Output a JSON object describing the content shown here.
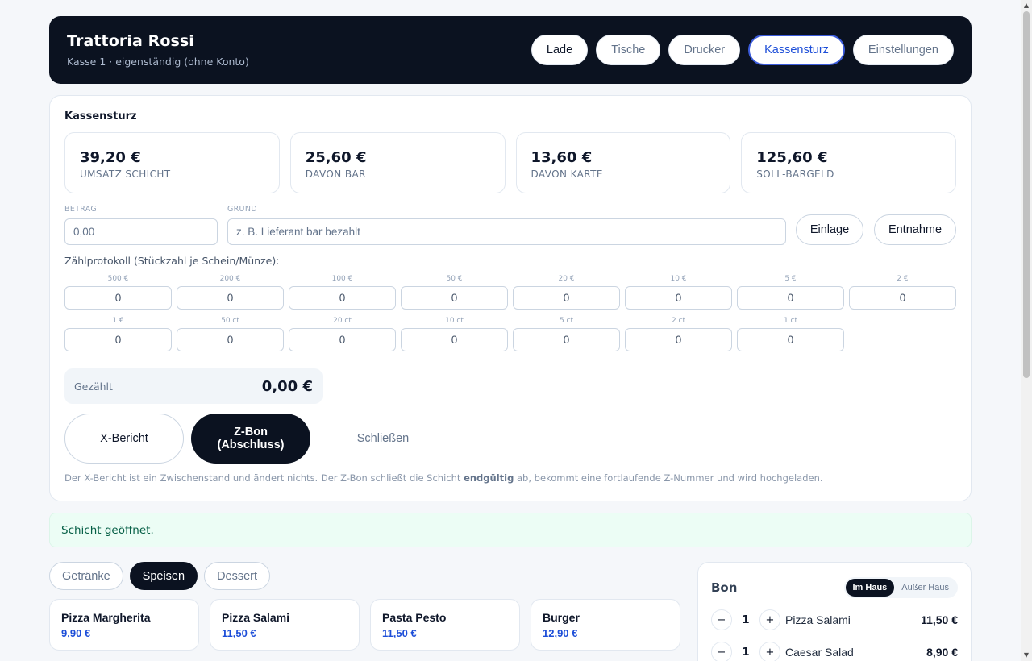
{
  "header": {
    "title": "Trattoria Rossi",
    "subtitle": "Kasse 1 · eigenständig (ohne Konto)",
    "nav": [
      {
        "label": "Lade"
      },
      {
        "label": "Tische"
      },
      {
        "label": "Drucker"
      },
      {
        "label": "Kassensturz",
        "active": true
      },
      {
        "label": "Einstellungen"
      }
    ]
  },
  "kassensturz": {
    "title": "Kassensturz",
    "stats": [
      {
        "value": "39,20 €",
        "label": "UMSATZ SCHICHT"
      },
      {
        "value": "25,60 €",
        "label": "DAVON BAR"
      },
      {
        "value": "13,60 €",
        "label": "DAVON KARTE"
      },
      {
        "value": "125,60 €",
        "label": "SOLL-BARGELD"
      }
    ],
    "amount_label": "BETRAG",
    "amount_placeholder": "0,00",
    "reason_label": "GRUND",
    "reason_placeholder": "z. B. Lieferant bar bezahlt",
    "deposit_label": "Einlage",
    "withdraw_label": "Entnahme",
    "count_title": "Zählprotokoll (Stückzahl je Schein/Münze):",
    "denominations": [
      {
        "label": "500 €",
        "value": "0"
      },
      {
        "label": "200 €",
        "value": "0"
      },
      {
        "label": "100 €",
        "value": "0"
      },
      {
        "label": "50 €",
        "value": "0"
      },
      {
        "label": "20 €",
        "value": "0"
      },
      {
        "label": "10 €",
        "value": "0"
      },
      {
        "label": "5 €",
        "value": "0"
      },
      {
        "label": "2 €",
        "value": "0"
      },
      {
        "label": "1 €",
        "value": "0"
      },
      {
        "label": "50 ct",
        "value": "0"
      },
      {
        "label": "20 ct",
        "value": "0"
      },
      {
        "label": "10 ct",
        "value": "0"
      },
      {
        "label": "5 ct",
        "value": "0"
      },
      {
        "label": "2 ct",
        "value": "0"
      },
      {
        "label": "1 ct",
        "value": "0"
      }
    ],
    "counted_label": "Gezählt",
    "counted_value": "0,00 €",
    "x_report_label": "X-Bericht",
    "z_bon_line1": "Z-Bon",
    "z_bon_line2": "(Abschluss)",
    "close_label": "Schließen",
    "note_pre": "Der X-Bericht ist ein Zwischenstand und ändert nichts. Der Z-Bon schließt die Schicht ",
    "note_bold": "endgültig",
    "note_post": " ab, bekommt eine fortlaufende Z-Nummer und wird hochgeladen."
  },
  "status": "Schicht geöffnet.",
  "categories": [
    {
      "label": "Getränke"
    },
    {
      "label": "Speisen",
      "active": true
    },
    {
      "label": "Dessert"
    }
  ],
  "products": [
    {
      "name": "Pizza Margherita",
      "price": "9,90 €"
    },
    {
      "name": "Pizza Salami",
      "price": "11,50 €"
    },
    {
      "name": "Pasta Pesto",
      "price": "11,50 €"
    },
    {
      "name": "Burger",
      "price": "12,90 €"
    }
  ],
  "bon": {
    "title": "Bon",
    "mode_in": "Im Haus",
    "mode_out": "Außer Haus",
    "lines": [
      {
        "qty": "1",
        "name": "Pizza Salami",
        "price": "11,50 €"
      },
      {
        "qty": "1",
        "name": "Caesar Salad",
        "price": "8,90 €"
      }
    ]
  },
  "colors": {
    "header_bg": "#0b1220",
    "accent": "#1d4ed8",
    "status_bg": "#ecfdf5"
  }
}
